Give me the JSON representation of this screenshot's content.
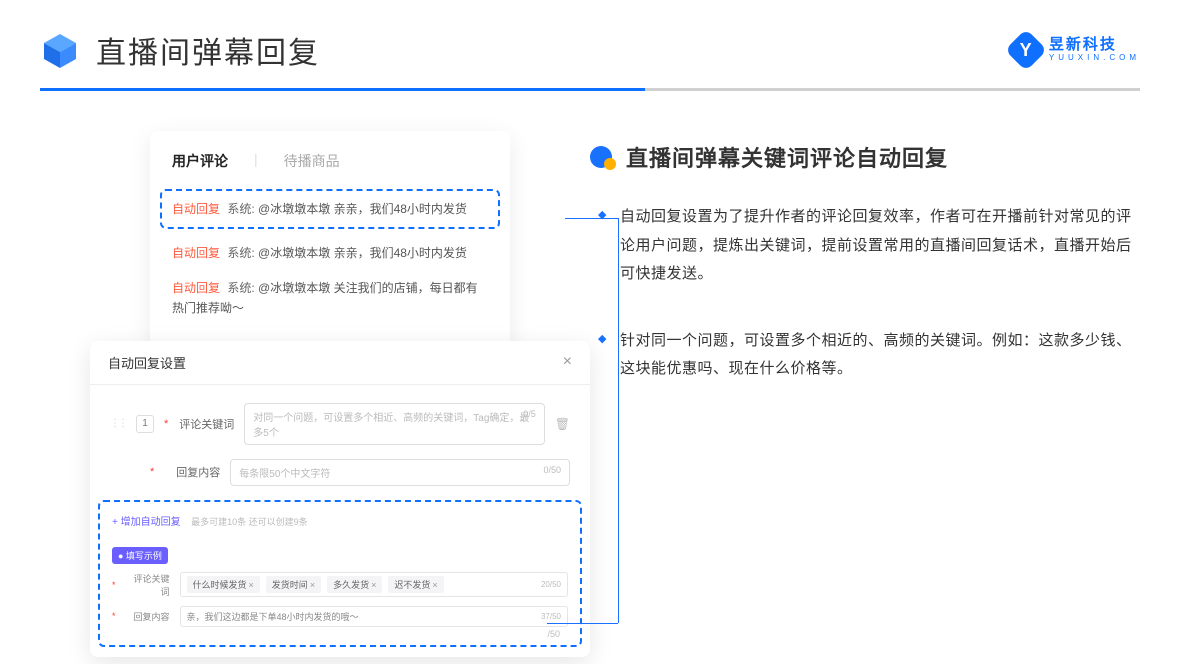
{
  "header": {
    "title": "直播间弹幕回复",
    "brand_cn": "昱新科技",
    "brand_en": "YUUXIN.COM",
    "brand_letter": "Y"
  },
  "comments": {
    "tab_active": "用户评论",
    "tab_inactive": "待播商品",
    "items": [
      {
        "auto": "自动回复",
        "sys": "系统:",
        "text": "@冰墩墩本墩 亲亲，我们48小时内发货"
      },
      {
        "auto": "自动回复",
        "sys": "系统:",
        "text": "@冰墩墩本墩 亲亲，我们48小时内发货"
      },
      {
        "auto": "自动回复",
        "sys": "系统:",
        "text": "@冰墩墩本墩 关注我们的店铺，每日都有热门推荐呦～"
      }
    ]
  },
  "settings": {
    "title": "自动回复设置",
    "row_num": "1",
    "label_keyword": "评论关键词",
    "placeholder_keyword": "对同一个问题，可设置多个相近、高频的关键词，Tag确定，最多5个",
    "counter_keyword": "0/5",
    "label_content": "回复内容",
    "placeholder_content": "每条限50个中文字符",
    "counter_content": "0/50",
    "add_link": "+ 增加自动回复",
    "add_hint": "最多可建10条 还可以创建9条",
    "example_badge": "● 填写示例",
    "ex_label_keyword": "评论关键词",
    "ex_tags": [
      "什么时候发货",
      "发货时间",
      "多久发货",
      "迟不发货"
    ],
    "ex_counter_keyword": "20/50",
    "ex_label_content": "回复内容",
    "ex_content": "亲，我们这边都是下单48小时内发货的哦～",
    "ex_counter_content": "37/50",
    "stray_counter": "/50"
  },
  "right": {
    "heading": "直播间弹幕关键词评论自动回复",
    "bullets": [
      "自动回复设置为了提升作者的评论回复效率，作者可在开播前针对常见的评论用户问题，提炼出关键词，提前设置常用的直播间回复话术，直播开始后可快捷发送。",
      "针对同一个问题，可设置多个相近的、高频的关键词。例如：这款多少钱、这块能优惠吗、现在什么价格等。"
    ]
  }
}
